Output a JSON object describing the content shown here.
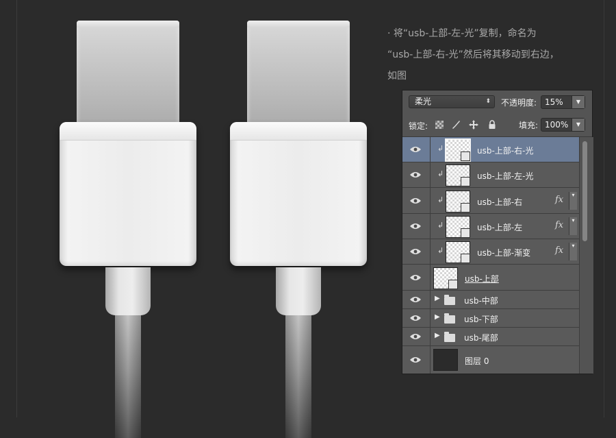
{
  "caption": {
    "line1": "· 将“usb-上部-左-光”复制，命名为",
    "line2": "“usb-上部-右-光”然后将其移动到右边，",
    "line3": "如图"
  },
  "layers_panel": {
    "blend_mode": "柔光",
    "opacity_label": "不透明度:",
    "opacity_value": "15%",
    "lock_label": "锁定:",
    "fill_label": "填充:",
    "fill_value": "100%",
    "layers": [
      {
        "name": "usb-上部-右-光",
        "clipped": true,
        "fx": false,
        "selected": true,
        "type": "layer"
      },
      {
        "name": "usb-上部-左-光",
        "clipped": true,
        "fx": false,
        "selected": false,
        "type": "layer"
      },
      {
        "name": "usb-上部-右",
        "clipped": true,
        "fx": true,
        "selected": false,
        "type": "layer"
      },
      {
        "name": "usb-上部-左",
        "clipped": true,
        "fx": true,
        "selected": false,
        "type": "layer"
      },
      {
        "name": "usb-上部-渐变",
        "clipped": true,
        "fx": true,
        "selected": false,
        "type": "layer"
      },
      {
        "name": "usb-上部",
        "clipped": false,
        "fx": false,
        "selected": false,
        "type": "base"
      },
      {
        "name": "usb-中部",
        "type": "group"
      },
      {
        "name": "usb-下部",
        "type": "group"
      },
      {
        "name": "usb-尾部",
        "type": "group"
      },
      {
        "name": "图层 0",
        "type": "fill-layer"
      }
    ],
    "fx_label": "fx",
    "icons": {
      "eye": "eye-icon",
      "clip": "clip-arrow-icon",
      "folder": "folder-icon",
      "expand": "triangle-right-icon"
    }
  },
  "colors": {
    "background": "#2b2b2b",
    "selected_layer": "#6b7c97",
    "panel": "#5a5a5a"
  }
}
